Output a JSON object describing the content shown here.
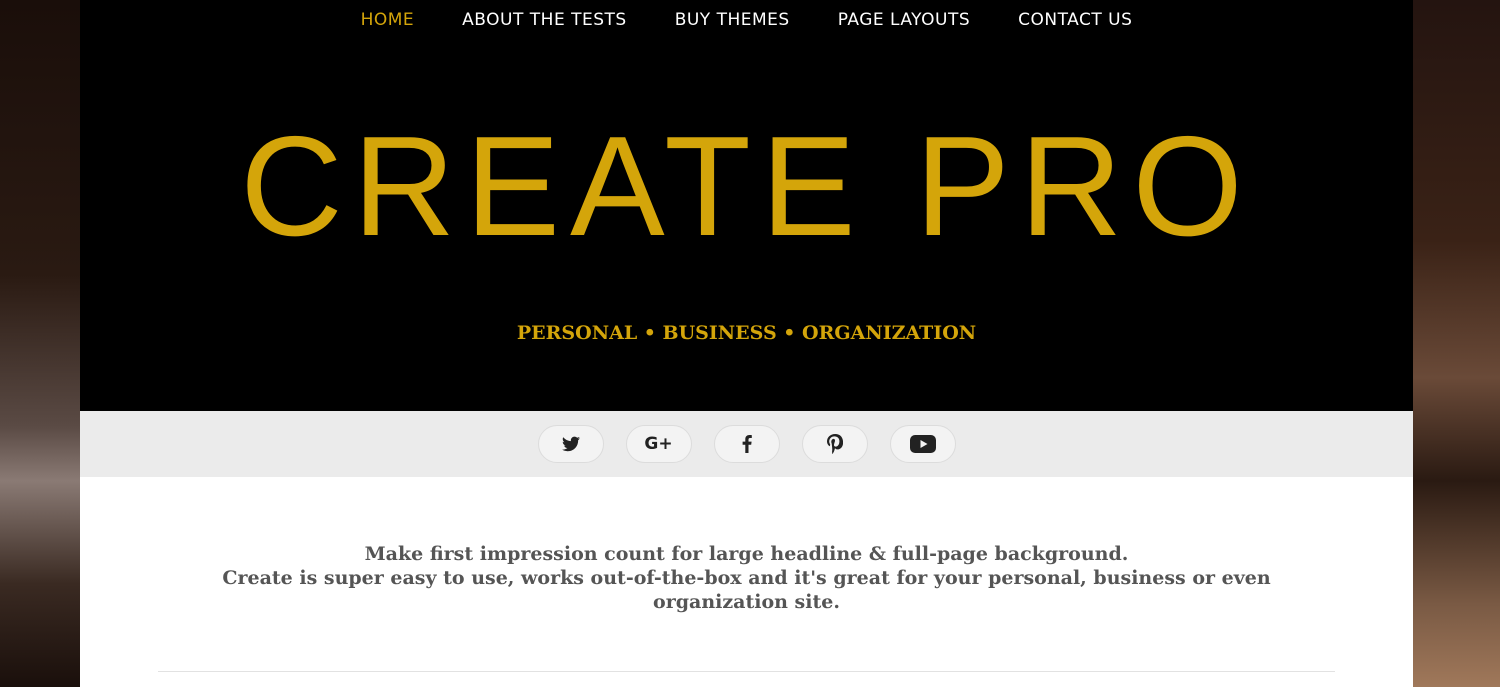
{
  "nav": {
    "items": [
      {
        "label": "HOME",
        "active": true
      },
      {
        "label": "ABOUT THE TESTS",
        "active": false
      },
      {
        "label": "BUY THEMES",
        "active": false
      },
      {
        "label": "PAGE LAYOUTS",
        "active": false
      },
      {
        "label": "CONTACT US",
        "active": false
      }
    ]
  },
  "header": {
    "site_title": "CREATE PRO",
    "tagline": "PERSONAL • BUSINESS • ORGANIZATION"
  },
  "social": {
    "icons": [
      "twitter-icon",
      "google-plus-icon",
      "facebook-icon",
      "pinterest-icon",
      "youtube-icon"
    ],
    "google_plus_glyph": "G+"
  },
  "intro": {
    "line1": "Make first impression count for large headline & full-page background.",
    "line2": "Create is super easy to use, works out-of-the-box and it's great for your personal, business or even",
    "line3": "organization site."
  },
  "colors": {
    "accent": "#d4a50a",
    "header_bg": "#000000",
    "social_bar_bg": "#ebebeb",
    "intro_text": "#555555"
  }
}
